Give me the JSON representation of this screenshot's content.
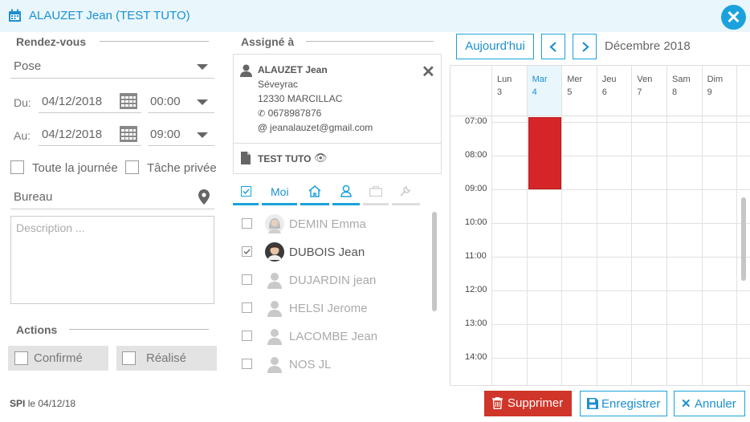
{
  "header": {
    "title": "ALAUZET Jean (TEST TUTO)"
  },
  "rdv": {
    "section_label": "Rendez-vous",
    "type_value": "Pose",
    "du_label": "Du:",
    "du_date": "04/12/2018",
    "du_time": "00:00",
    "au_label": "Au:",
    "au_date": "04/12/2018",
    "au_time": "09:00",
    "allday_label": "Toute la journée",
    "private_label": "Tâche privée",
    "location_value": "Bureau",
    "description_placeholder": "Description ..."
  },
  "actions": {
    "section_label": "Actions",
    "confirmed_label": "Confirmé",
    "done_label": "Réalisé"
  },
  "footer": {
    "author": "SPI",
    "le": "le",
    "date": "04/12/18"
  },
  "assign": {
    "section_label": "Assigné à",
    "contact": {
      "name": "ALAUZET Jean",
      "line1": "Séveyrac",
      "line2": "12330 MARCILLAC",
      "phone": "0678987876",
      "email": "jeanalauzet@gmail.com"
    },
    "doc_label": "TEST TUTO",
    "tab_me": "Moi",
    "people": [
      {
        "name": "DEMIN Emma",
        "checked": false,
        "photo": "female"
      },
      {
        "name": "DUBOIS Jean",
        "checked": true,
        "photo": "male"
      },
      {
        "name": "DUJARDIN jean",
        "checked": false,
        "photo": "none"
      },
      {
        "name": "HELSI Jerome",
        "checked": false,
        "photo": "none"
      },
      {
        "name": "LACOMBE Jean",
        "checked": false,
        "photo": "none"
      },
      {
        "name": "NOS JL",
        "checked": false,
        "photo": "none"
      }
    ]
  },
  "calendar": {
    "today_label": "Aujourd'hui",
    "month_label": "Décembre 2018",
    "days": [
      {
        "name": "Lun",
        "num": "3",
        "today": false
      },
      {
        "name": "Mar",
        "num": "4",
        "today": true
      },
      {
        "name": "Mer",
        "num": "5",
        "today": false
      },
      {
        "name": "Jeu",
        "num": "6",
        "today": false
      },
      {
        "name": "Ven",
        "num": "7",
        "today": false
      },
      {
        "name": "Sam",
        "num": "8",
        "today": false
      },
      {
        "name": "Dim",
        "num": "9",
        "today": false
      }
    ],
    "hours": [
      "07:00",
      "08:00",
      "09:00",
      "10:00",
      "11:00",
      "12:00",
      "13:00",
      "14:00"
    ],
    "event": {
      "day": "Mar",
      "start": "07:00",
      "end": "09:00",
      "color": "#d62528"
    }
  },
  "buttons": {
    "delete": "Supprimer",
    "save": "Enregistrer",
    "cancel": "Annuler"
  },
  "colors": {
    "accent": "#1ba2dc",
    "danger": "#d0352a",
    "header_bg": "#e9f7fd"
  }
}
